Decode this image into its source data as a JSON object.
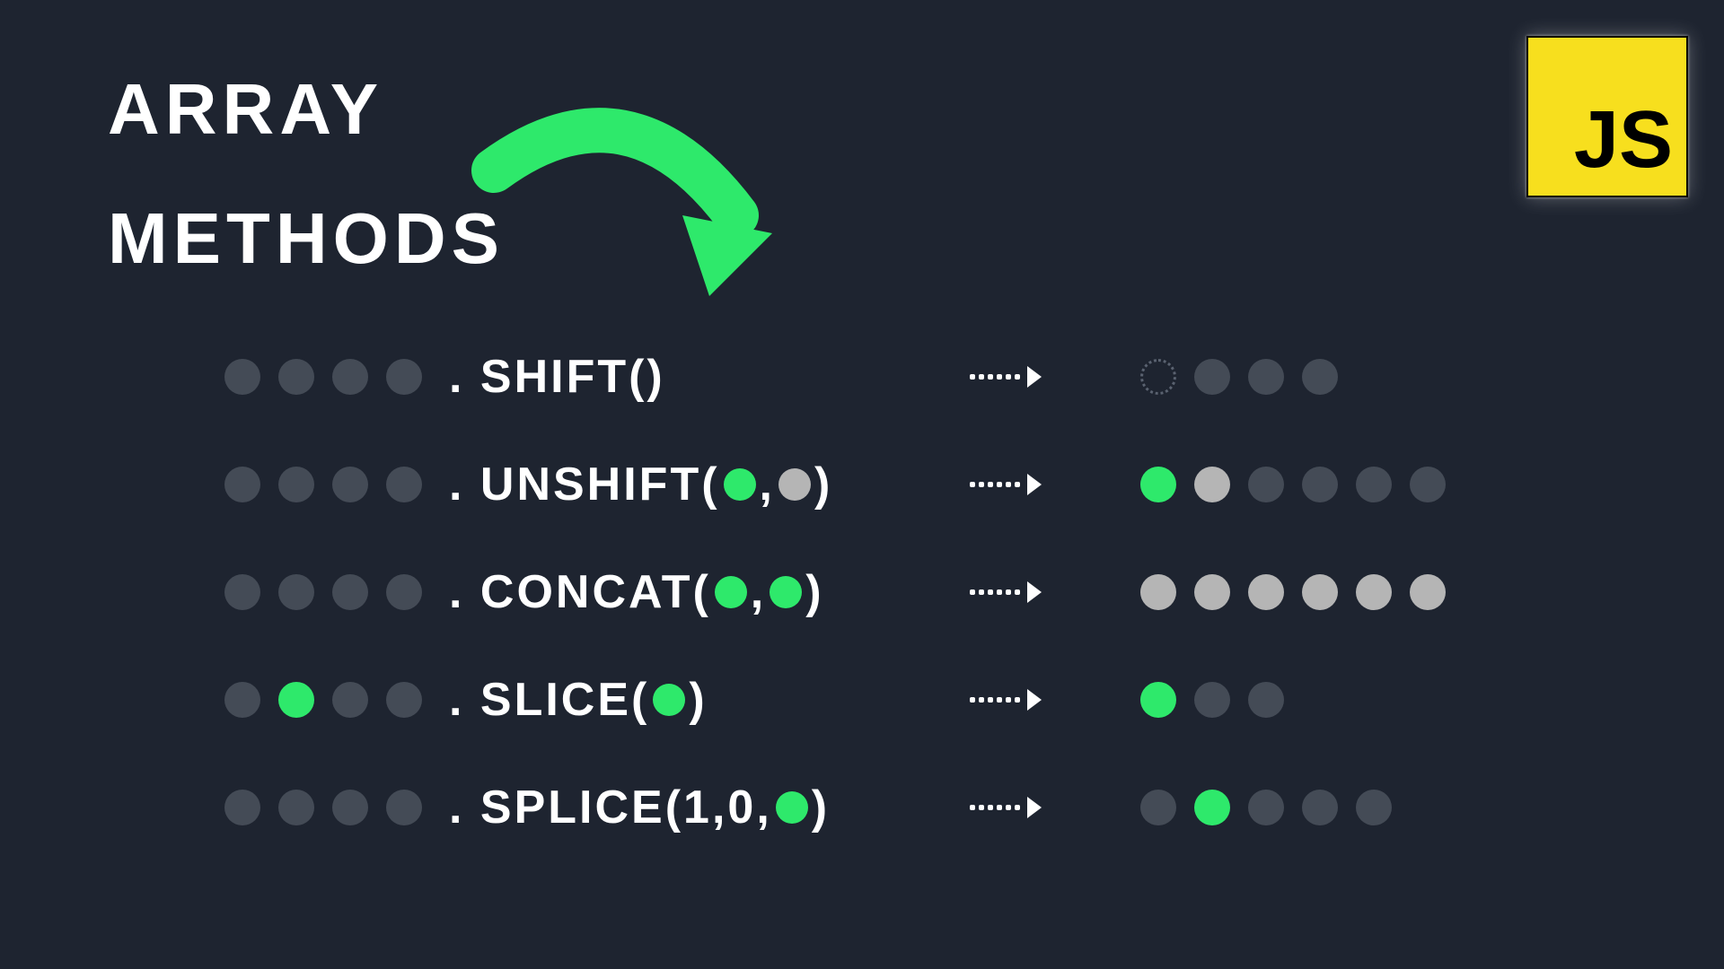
{
  "title": {
    "line1": "ARRAY",
    "line2": "METHODS"
  },
  "badge": {
    "text": "JS"
  },
  "methods": [
    {
      "id": "shift",
      "before": [
        "dark",
        "dark",
        "dark",
        "dark"
      ],
      "label": {
        "prefix": ". SHIFT(",
        "args": [],
        "suffix": ")"
      },
      "after": [
        "ghost",
        "dark",
        "dark",
        "dark"
      ]
    },
    {
      "id": "unshift",
      "before": [
        "dark",
        "dark",
        "dark",
        "dark"
      ],
      "label": {
        "prefix": ". UNSHIFT(",
        "args": [
          "green",
          "light"
        ],
        "suffix": ")"
      },
      "after": [
        "green",
        "light",
        "dark",
        "dark",
        "dark",
        "dark"
      ]
    },
    {
      "id": "concat",
      "before": [
        "dark",
        "dark",
        "dark",
        "dark"
      ],
      "label": {
        "prefix": ". CONCAT(",
        "args": [
          "green",
          "green"
        ],
        "suffix": ")"
      },
      "after": [
        "light",
        "light",
        "light",
        "light",
        "light",
        "light"
      ]
    },
    {
      "id": "slice",
      "before": [
        "dark",
        "green",
        "dark",
        "dark"
      ],
      "label": {
        "prefix": ". SLICE(",
        "args": [
          "green"
        ],
        "suffix": ")"
      },
      "after": [
        "green",
        "dark",
        "dark"
      ]
    },
    {
      "id": "splice",
      "before": [
        "dark",
        "dark",
        "dark",
        "dark"
      ],
      "label": {
        "prefix": ". SPLICE(1,0,",
        "args": [
          "green"
        ],
        "suffix": ")"
      },
      "after": [
        "dark",
        "green",
        "dark",
        "dark",
        "dark"
      ]
    }
  ]
}
